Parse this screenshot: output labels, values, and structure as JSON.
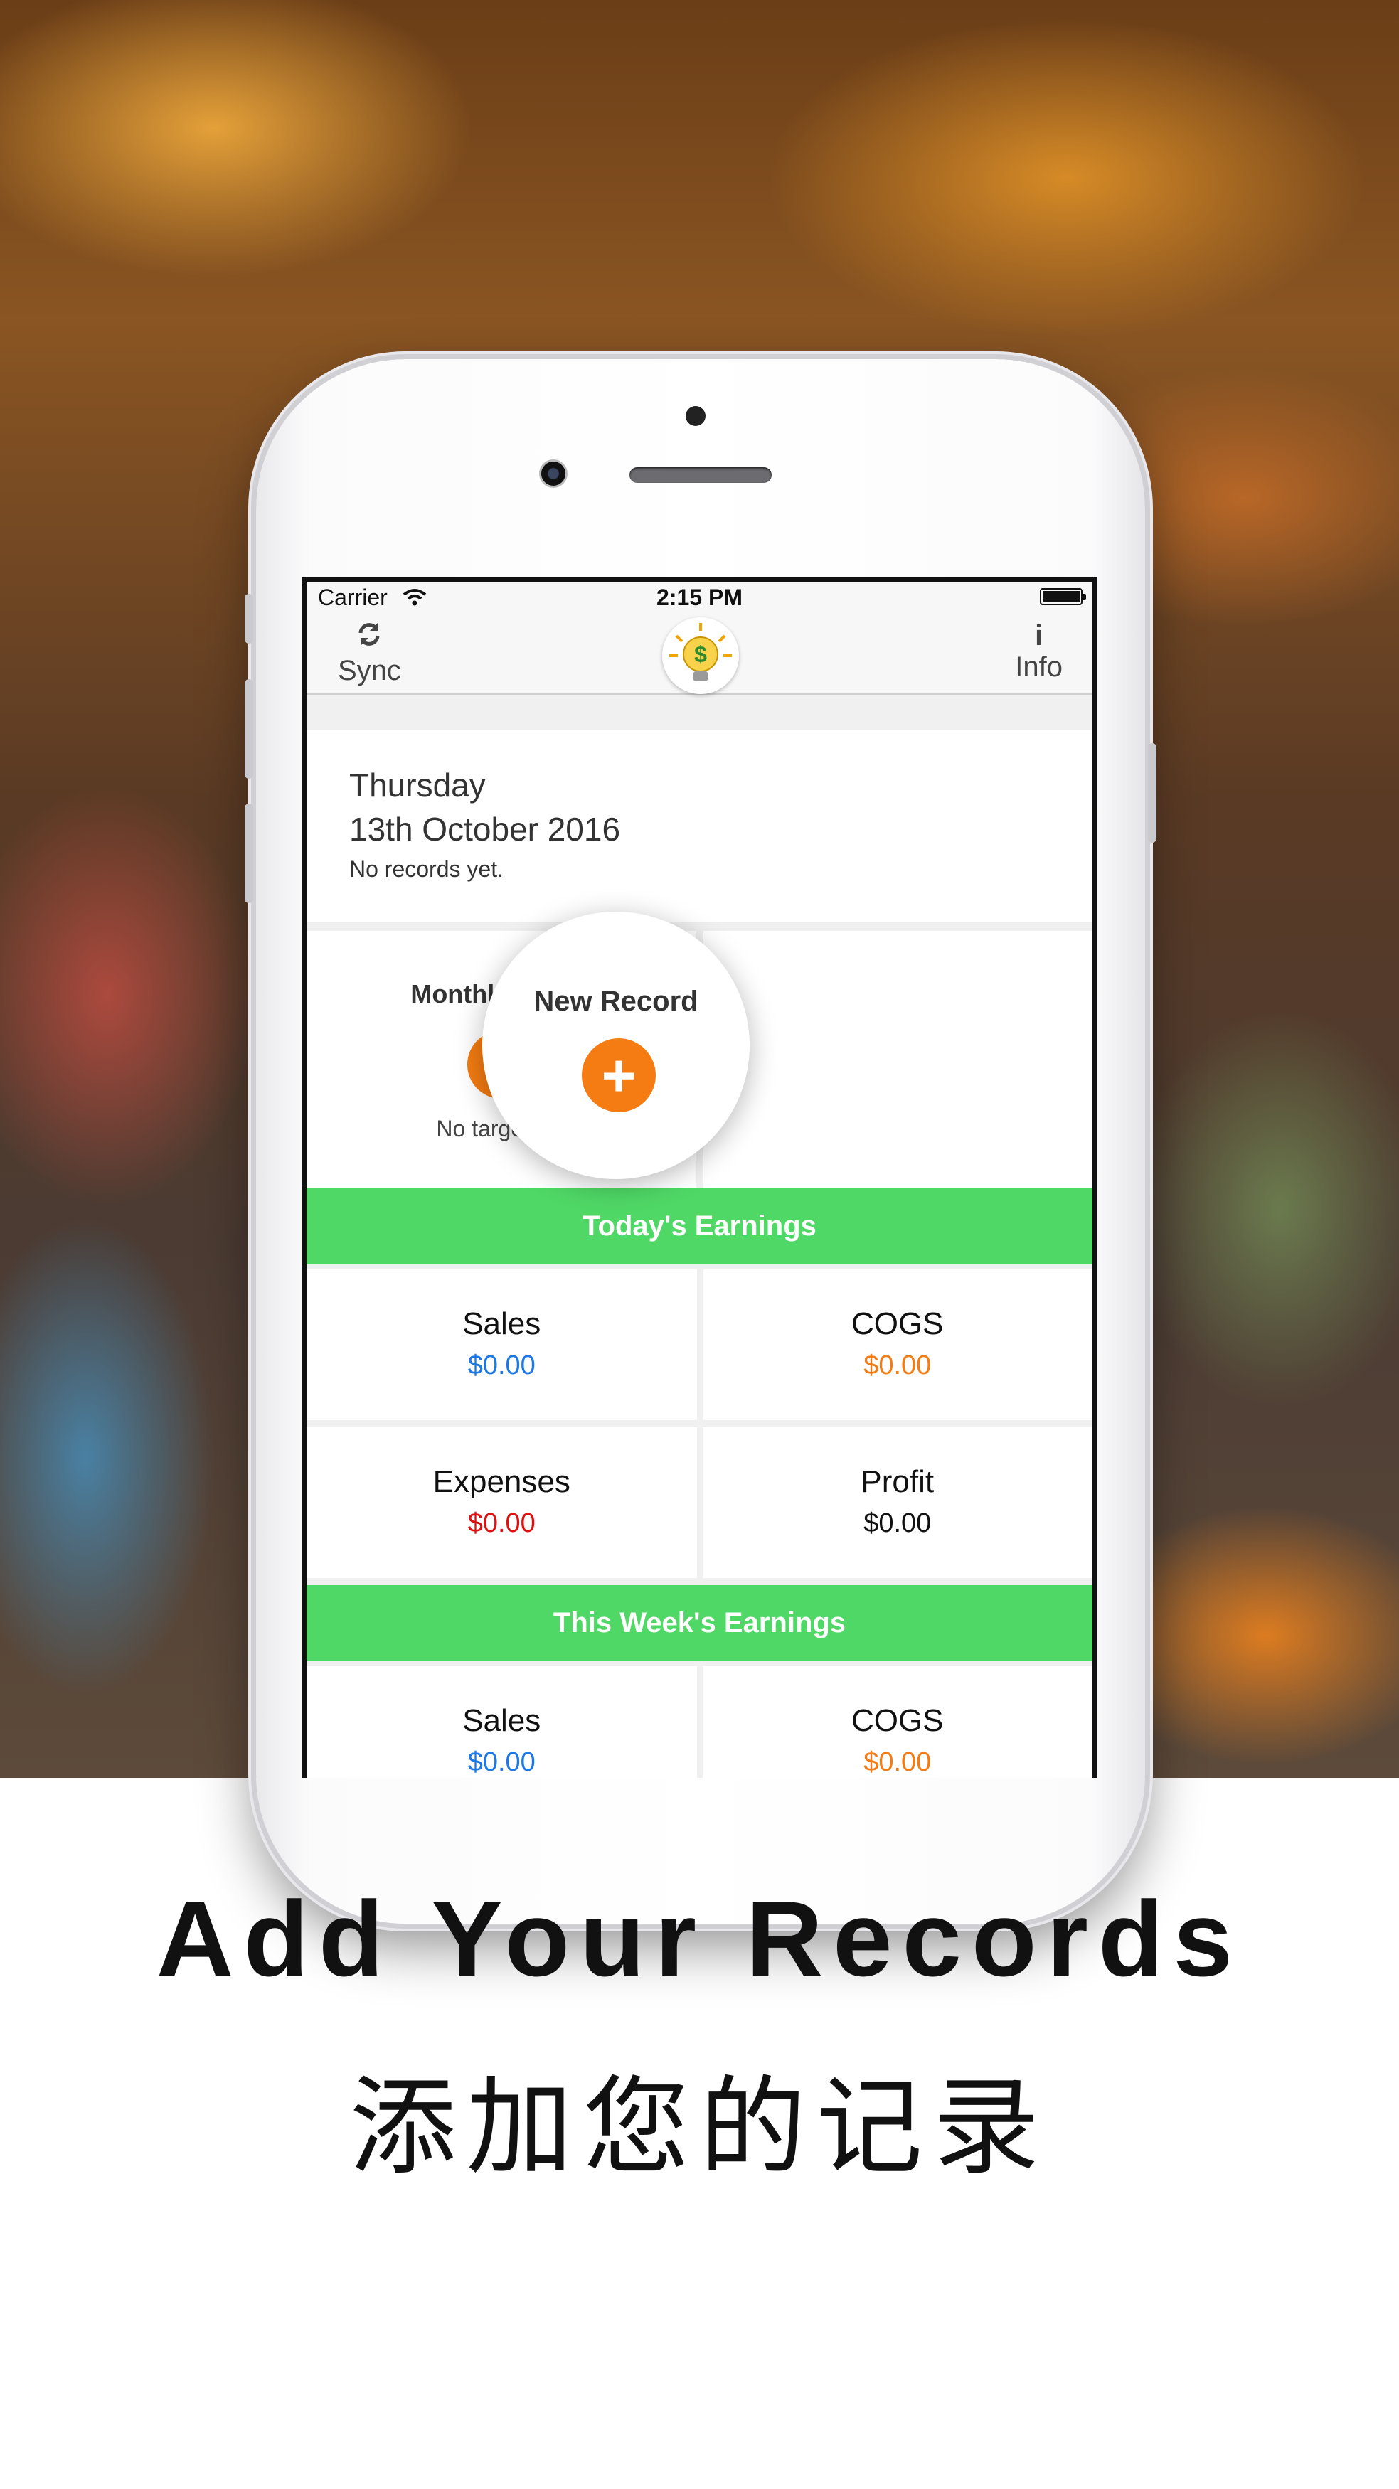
{
  "status_bar": {
    "carrier": "Carrier",
    "time": "2:15 PM"
  },
  "nav": {
    "sync_label": "Sync",
    "info_label": "Info",
    "sync_icon": "refresh-icon",
    "info_icon": "info-icon",
    "logo_icon": "lightbulb-dollar-logo"
  },
  "date_card": {
    "day": "Thursday",
    "date": "13th October 2016",
    "note": "No records yet."
  },
  "monthly_target": {
    "title": "Monthly Target",
    "status": "No target set"
  },
  "new_record": {
    "title": "New Record"
  },
  "today": {
    "header": "Today's Earnings",
    "metrics": [
      {
        "label": "Sales",
        "value": "$0.00",
        "color": "#1a78e8"
      },
      {
        "label": "COGS",
        "value": "$0.00",
        "color": "#f47c12"
      },
      {
        "label": "Expenses",
        "value": "$0.00",
        "color": "#e01010"
      },
      {
        "label": "Profit",
        "value": "$0.00",
        "color": "#111111"
      }
    ]
  },
  "week": {
    "header": "This Week's Earnings",
    "metrics": [
      {
        "label": "Sales",
        "value": "$0.00",
        "color": "#1a78e8"
      },
      {
        "label": "COGS",
        "value": "$0.00",
        "color": "#f47c12"
      }
    ]
  },
  "colors": {
    "accent_green": "#4fd866",
    "accent_orange": "#f47c12"
  },
  "caption": {
    "english": "Add Your Records",
    "chinese": "添加您的记录"
  }
}
